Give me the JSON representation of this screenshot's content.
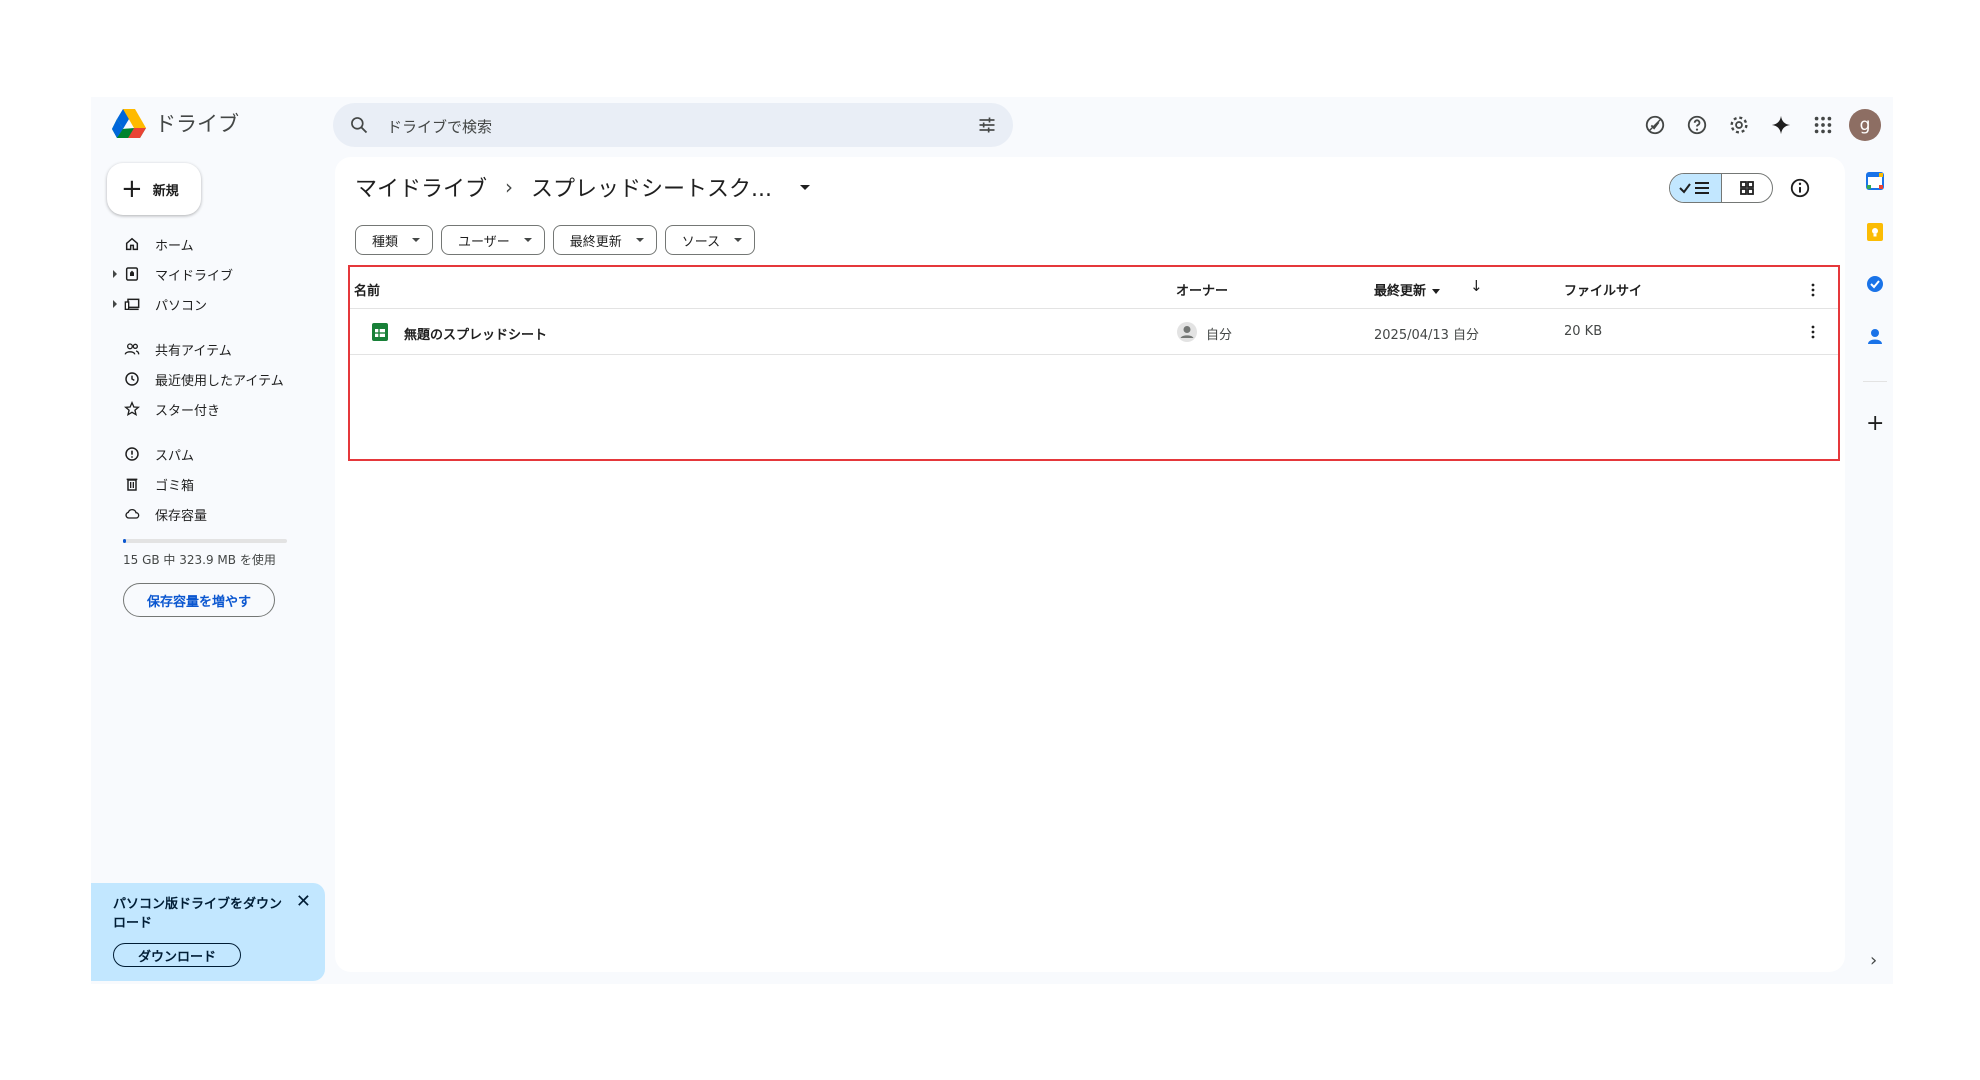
{
  "app": {
    "name": "ドライブ"
  },
  "search": {
    "placeholder": "ドライブで検索"
  },
  "header": {
    "icons": [
      "offline-check-icon",
      "help-icon",
      "settings-icon",
      "gemini-icon",
      "apps-grid-icon"
    ],
    "avatar_letter": "g",
    "avatar_color": "#8d6e63"
  },
  "sidebar": {
    "new_label": "新規",
    "items": [
      {
        "label": "ホーム",
        "icon": "home-icon"
      },
      {
        "label": "マイドライブ",
        "icon": "my-drive-icon"
      },
      {
        "label": "パソコン",
        "icon": "computer-icon"
      },
      {
        "label": "共有アイテム",
        "icon": "shared-icon"
      },
      {
        "label": "最近使用したアイテム",
        "icon": "clock-icon"
      },
      {
        "label": "スター付き",
        "icon": "star-icon"
      },
      {
        "label": "スパム",
        "icon": "spam-icon"
      },
      {
        "label": "ゴミ箱",
        "icon": "trash-icon"
      },
      {
        "label": "保存容量",
        "icon": "cloud-icon"
      }
    ],
    "storage": {
      "text": "15 GB 中 323.9 MB を使用",
      "used_fraction": 0.021
    },
    "upgrade_label": "保存容量を増やす"
  },
  "promo": {
    "text": "パソコン版ドライブをダウンロード",
    "close": "✕",
    "button": "ダウンロード"
  },
  "main": {
    "breadcrumb": {
      "root": "マイドライブ",
      "sep": "›",
      "current": "スプレッドシートスク..."
    },
    "filters": [
      "種類",
      "ユーザー",
      "最終更新",
      "ソース"
    ],
    "columns": {
      "name": "名前",
      "owner": "オーナー",
      "modified": "最終更新",
      "size": "ファイルサイ"
    },
    "sort_arrow": "↓",
    "rows": [
      {
        "name": "無題のスプレッドシート",
        "owner": "自分",
        "modified": "2025/04/13 自分",
        "size": "20 KB"
      }
    ]
  },
  "right_panel": {
    "icons": [
      "calendar-icon",
      "keep-icon",
      "tasks-icon",
      "contacts-icon"
    ],
    "add": "+",
    "expand": "›"
  },
  "colors": {
    "accent": "#0b57d0",
    "highlight": "#e5383b",
    "sheets_green": "#188038"
  }
}
